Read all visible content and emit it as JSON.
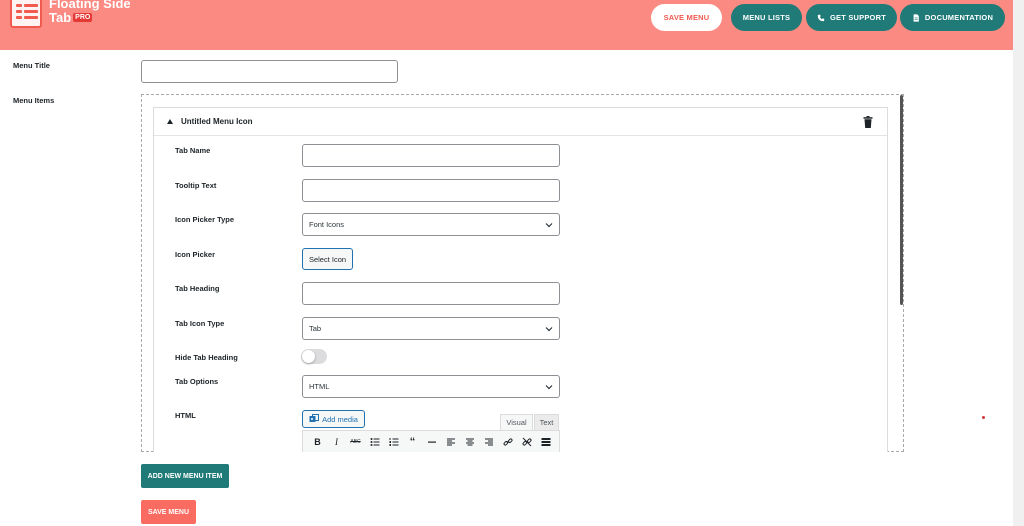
{
  "header": {
    "logo_title_line1": "Floating Side",
    "logo_title_line2": "Tab",
    "logo_badge": "PRO",
    "buttons": {
      "save_menu": "SAVE MENU",
      "menu_lists": "MENU LISTS",
      "get_support": "GET SUPPORT",
      "documentation": "DOCUMENTATION"
    },
    "colors": {
      "header_bg": "#fa8a82",
      "teal": "#1f7a78",
      "accent_red": "#f05a4f"
    }
  },
  "form": {
    "menu_title_label": "Menu Title",
    "menu_title_value": "",
    "menu_items_label": "Menu Items"
  },
  "menu_item": {
    "title": "Untitled Menu Icon",
    "fields": {
      "tab_name": {
        "label": "Tab Name",
        "value": ""
      },
      "tooltip_text": {
        "label": "Tooltip Text",
        "value": ""
      },
      "icon_picker_type": {
        "label": "Icon Picker Type",
        "selected": "Font Icons"
      },
      "icon_picker": {
        "label": "Icon Picker",
        "button": "Select Icon"
      },
      "tab_heading": {
        "label": "Tab Heading",
        "value": ""
      },
      "tab_icon_type": {
        "label": "Tab Icon Type",
        "selected": "Tab"
      },
      "hide_tab_heading": {
        "label": "Hide Tab Heading",
        "enabled": false
      },
      "tab_options": {
        "label": "Tab Options",
        "selected": "HTML"
      },
      "html": {
        "label": "HTML",
        "add_media": "Add media",
        "tab_visual": "Visual",
        "tab_text": "Text"
      }
    },
    "editor_toolbar": [
      "bold-icon",
      "italic-icon",
      "strikethrough-icon",
      "bullet-list-icon",
      "numbered-list-icon",
      "blockquote-icon",
      "horizontal-line-icon",
      "align-left-icon",
      "align-center-icon",
      "align-right-icon",
      "link-icon",
      "unlink-icon",
      "toolbar-toggle-icon"
    ]
  },
  "actions": {
    "add_new_menu_item": "ADD NEW MENU ITEM",
    "save_menu": "SAVE MENU"
  }
}
